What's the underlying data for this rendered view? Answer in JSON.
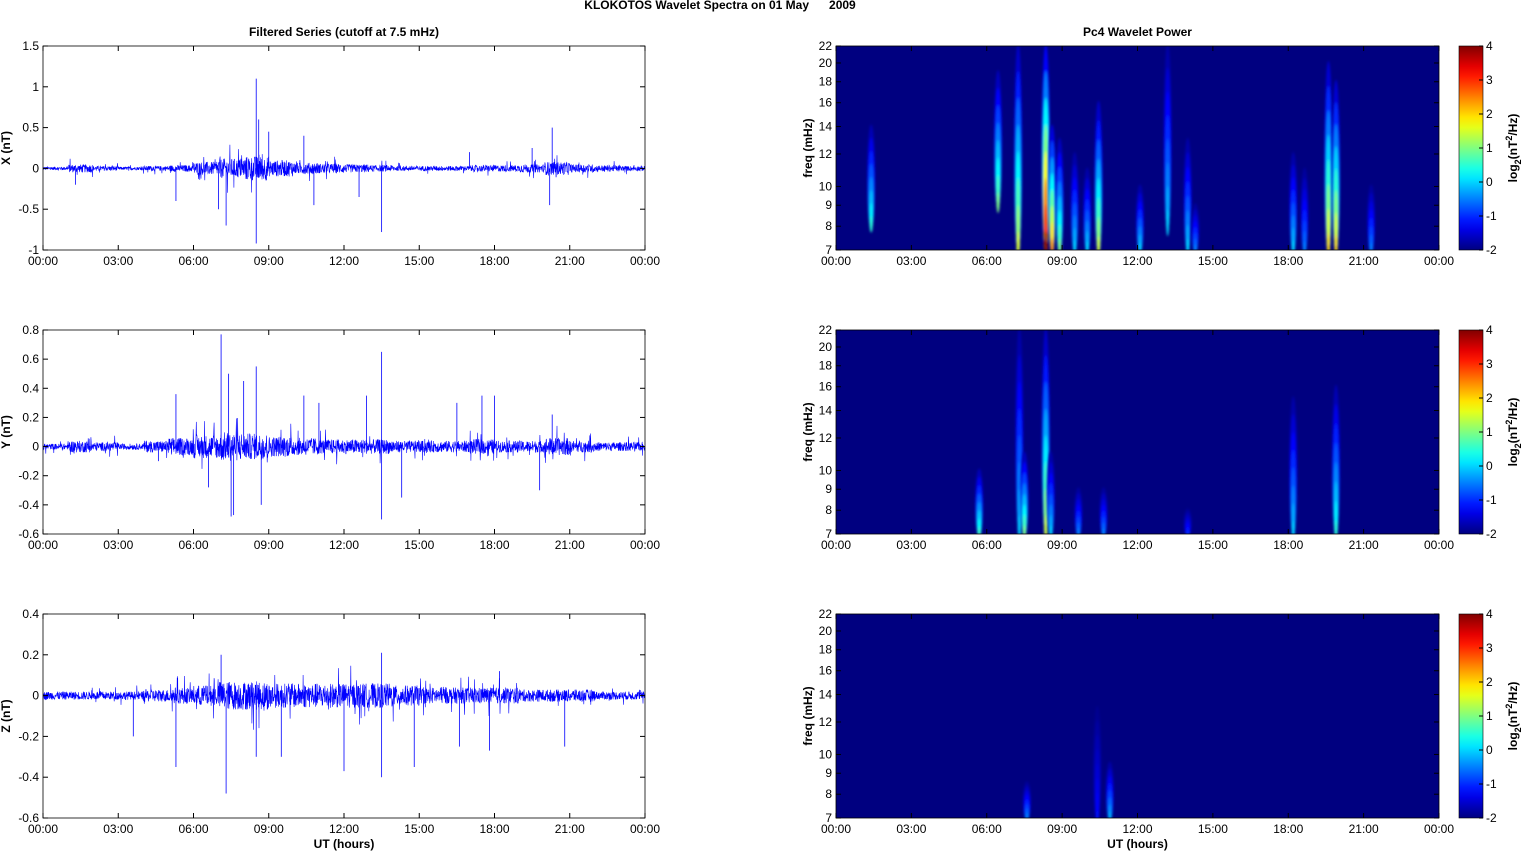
{
  "figure_title": "KLOKOTOS Wavelet Spectra on 01 May      2009",
  "chart_data": [
    {
      "type": "line",
      "panel": "X",
      "title": "Filtered Series (cutoff at 7.5 mHz)",
      "xlabel": "",
      "ylabel": "X (nT)",
      "xlim": [
        0,
        24
      ],
      "xticks": [
        "00:00",
        "03:00",
        "06:00",
        "09:00",
        "12:00",
        "15:00",
        "18:00",
        "21:00",
        "00:00"
      ],
      "ylim": [
        -1,
        1.5
      ],
      "yticks": [
        "-1",
        "-0.5",
        "0",
        "0.5",
        "1",
        "1.5"
      ],
      "yvals": [
        -1,
        -0.5,
        0,
        0.5,
        1,
        1.5
      ],
      "color": "#0000ff",
      "envelope_by_hour": [
        0.02,
        0.05,
        0.03,
        0.02,
        0.03,
        0.04,
        0.08,
        0.12,
        0.15,
        0.1,
        0.07,
        0.06,
        0.05,
        0.04,
        0.03,
        0.03,
        0.03,
        0.04,
        0.04,
        0.05,
        0.08,
        0.05,
        0.04,
        0.03
      ],
      "spikes": [
        [
          8.5,
          1.1
        ],
        [
          8.5,
          -0.92
        ],
        [
          8.6,
          0.6
        ],
        [
          7.3,
          -0.7
        ],
        [
          7.0,
          -0.5
        ],
        [
          5.3,
          -0.4
        ],
        [
          9.0,
          0.45
        ],
        [
          10.4,
          0.4
        ],
        [
          10.8,
          -0.45
        ],
        [
          13.5,
          -0.78
        ],
        [
          12.6,
          -0.35
        ],
        [
          20.3,
          0.5
        ],
        [
          20.2,
          -0.45
        ],
        [
          19.5,
          0.25
        ],
        [
          1.3,
          -0.2
        ],
        [
          17.0,
          0.2
        ]
      ]
    },
    {
      "type": "line",
      "panel": "Y",
      "ylabel": "Y (nT)",
      "xlim": [
        0,
        24
      ],
      "xticks": [
        "00:00",
        "03:00",
        "06:00",
        "09:00",
        "12:00",
        "15:00",
        "18:00",
        "21:00",
        "00:00"
      ],
      "ylim": [
        -0.6,
        0.8
      ],
      "yticks": [
        "-0.6",
        "-0.4",
        "-0.2",
        "0",
        "0.2",
        "0.4",
        "0.6",
        "0.8"
      ],
      "yvals": [
        -0.6,
        -0.4,
        -0.2,
        0,
        0.2,
        0.4,
        0.6,
        0.8
      ],
      "color": "#0000ff",
      "envelope_by_hour": [
        0.02,
        0.04,
        0.03,
        0.02,
        0.04,
        0.06,
        0.08,
        0.1,
        0.09,
        0.07,
        0.06,
        0.05,
        0.05,
        0.05,
        0.04,
        0.04,
        0.04,
        0.05,
        0.04,
        0.04,
        0.06,
        0.04,
        0.03,
        0.03
      ],
      "spikes": [
        [
          7.1,
          0.77
        ],
        [
          7.4,
          0.5
        ],
        [
          7.5,
          -0.48
        ],
        [
          7.6,
          -0.47
        ],
        [
          8.0,
          0.45
        ],
        [
          8.7,
          -0.4
        ],
        [
          8.5,
          0.55
        ],
        [
          10.4,
          0.35
        ],
        [
          11.0,
          0.3
        ],
        [
          12.9,
          0.35
        ],
        [
          13.5,
          0.65
        ],
        [
          13.5,
          -0.5
        ],
        [
          14.3,
          -0.35
        ],
        [
          16.5,
          0.3
        ],
        [
          17.5,
          0.35
        ],
        [
          18.0,
          0.35
        ],
        [
          20.3,
          0.22
        ],
        [
          19.8,
          -0.3
        ],
        [
          5.3,
          0.36
        ],
        [
          6.6,
          -0.28
        ],
        [
          4.6,
          -0.1
        ]
      ]
    },
    {
      "type": "line",
      "panel": "Z",
      "xlabel": "UT (hours)",
      "ylabel": "Z (nT)",
      "xlim": [
        0,
        24
      ],
      "xticks": [
        "00:00",
        "03:00",
        "06:00",
        "09:00",
        "12:00",
        "15:00",
        "18:00",
        "21:00",
        "00:00"
      ],
      "ylim": [
        -0.6,
        0.4
      ],
      "yticks": [
        "-0.6",
        "-0.4",
        "-0.2",
        "0",
        "0.2",
        "0.4"
      ],
      "yvals": [
        -0.6,
        -0.4,
        -0.2,
        0,
        0.2,
        0.4
      ],
      "color": "#0000ff",
      "envelope_by_hour": [
        0.02,
        0.02,
        0.02,
        0.02,
        0.03,
        0.04,
        0.05,
        0.07,
        0.07,
        0.06,
        0.06,
        0.06,
        0.06,
        0.06,
        0.05,
        0.04,
        0.04,
        0.04,
        0.04,
        0.03,
        0.03,
        0.03,
        0.02,
        0.02
      ],
      "spikes": [
        [
          7.3,
          -0.48
        ],
        [
          7.1,
          0.2
        ],
        [
          5.3,
          -0.35
        ],
        [
          3.6,
          -0.2
        ],
        [
          8.5,
          -0.3
        ],
        [
          9.5,
          -0.3
        ],
        [
          12.0,
          -0.37
        ],
        [
          13.5,
          0.21
        ],
        [
          13.5,
          -0.4
        ],
        [
          14.8,
          -0.35
        ],
        [
          16.6,
          -0.25
        ],
        [
          17.8,
          -0.27
        ],
        [
          20.8,
          -0.25
        ],
        [
          18.2,
          0.12
        ]
      ]
    },
    {
      "type": "heatmap",
      "panel": "X",
      "title": "Pc4 Wavelet Power",
      "ylabel": "freq (mHz)",
      "xlim": [
        0,
        24
      ],
      "ylim": [
        7,
        22
      ],
      "yscale": "log",
      "xticks": [
        "00:00",
        "03:00",
        "06:00",
        "09:00",
        "12:00",
        "15:00",
        "18:00",
        "21:00",
        "00:00"
      ],
      "yticks": [
        "7",
        "8",
        "9",
        "10",
        "12",
        "14",
        "16",
        "18",
        "20",
        "22"
      ],
      "yvals": [
        7,
        8,
        9,
        10,
        12,
        14,
        16,
        18,
        20,
        22
      ],
      "colorbar": {
        "label": "log2(nT2/Hz)",
        "range": [
          -2,
          4
        ],
        "ticks": [
          "-2",
          "-1",
          "0",
          "1",
          "2",
          "3",
          "4"
        ]
      },
      "events": [
        [
          1.4,
          8,
          14,
          0.5
        ],
        [
          6.45,
          9,
          19,
          1
        ],
        [
          7.25,
          7,
          22,
          1.6
        ],
        [
          8.35,
          7,
          22,
          4
        ],
        [
          8.6,
          7,
          14,
          2.5
        ],
        [
          8.9,
          7,
          13,
          1
        ],
        [
          9.5,
          7,
          12,
          0
        ],
        [
          10.0,
          7,
          11,
          0
        ],
        [
          10.45,
          7,
          16,
          1.5
        ],
        [
          12.1,
          7,
          10,
          0
        ],
        [
          13.2,
          8,
          22,
          0
        ],
        [
          14.0,
          7,
          13,
          0
        ],
        [
          14.3,
          7,
          9,
          -0.5
        ],
        [
          18.2,
          7,
          12,
          0
        ],
        [
          18.65,
          7,
          11,
          -0.5
        ],
        [
          19.6,
          7,
          20,
          2
        ],
        [
          19.9,
          7,
          18,
          2
        ],
        [
          21.3,
          7,
          10,
          -0.5
        ]
      ]
    },
    {
      "type": "heatmap",
      "panel": "Y",
      "ylabel": "freq (mHz)",
      "xlim": [
        0,
        24
      ],
      "ylim": [
        7,
        22
      ],
      "yscale": "log",
      "xticks": [
        "00:00",
        "03:00",
        "06:00",
        "09:00",
        "12:00",
        "15:00",
        "18:00",
        "21:00",
        "00:00"
      ],
      "yticks": [
        "7",
        "8",
        "9",
        "10",
        "12",
        "14",
        "16",
        "18",
        "20",
        "22"
      ],
      "yvals": [
        7,
        8,
        9,
        10,
        12,
        14,
        16,
        18,
        20,
        22
      ],
      "colorbar": {
        "label": "log2(nT2/Hz)",
        "range": [
          -2,
          4
        ],
        "ticks": [
          "-2",
          "-1",
          "0",
          "1",
          "2",
          "3",
          "4"
        ]
      },
      "events": [
        [
          5.7,
          7,
          10,
          0.6
        ],
        [
          7.3,
          7,
          22,
          0
        ],
        [
          7.5,
          7,
          11,
          1
        ],
        [
          8.35,
          7,
          22,
          1.5
        ],
        [
          8.55,
          7,
          11,
          0
        ],
        [
          9.65,
          7,
          9,
          -0.5
        ],
        [
          10.65,
          7,
          9,
          -0.5
        ],
        [
          14.0,
          7,
          8,
          -1
        ],
        [
          18.2,
          7,
          15,
          0
        ],
        [
          19.9,
          7,
          16,
          0.5
        ]
      ]
    },
    {
      "type": "heatmap",
      "panel": "Z",
      "xlabel": "UT (hours)",
      "ylabel": "freq (mHz)",
      "xlim": [
        0,
        24
      ],
      "ylim": [
        7,
        22
      ],
      "yscale": "log",
      "xticks": [
        "00:00",
        "03:00",
        "06:00",
        "09:00",
        "12:00",
        "15:00",
        "18:00",
        "21:00",
        "00:00"
      ],
      "yticks": [
        "7",
        "8",
        "9",
        "10",
        "12",
        "14",
        "16",
        "18",
        "20",
        "22"
      ],
      "yvals": [
        7,
        8,
        9,
        10,
        12,
        14,
        16,
        18,
        20,
        22
      ],
      "colorbar": {
        "label": "log2(nT2/Hz)",
        "range": [
          -2,
          4
        ],
        "ticks": [
          "-2",
          "-1",
          "0",
          "1",
          "2",
          "3",
          "4"
        ]
      },
      "events": [
        [
          7.6,
          7,
          8.5,
          -0.5
        ],
        [
          10.4,
          7,
          13,
          -1.2
        ],
        [
          10.9,
          7,
          9.5,
          -0.2
        ]
      ]
    }
  ]
}
